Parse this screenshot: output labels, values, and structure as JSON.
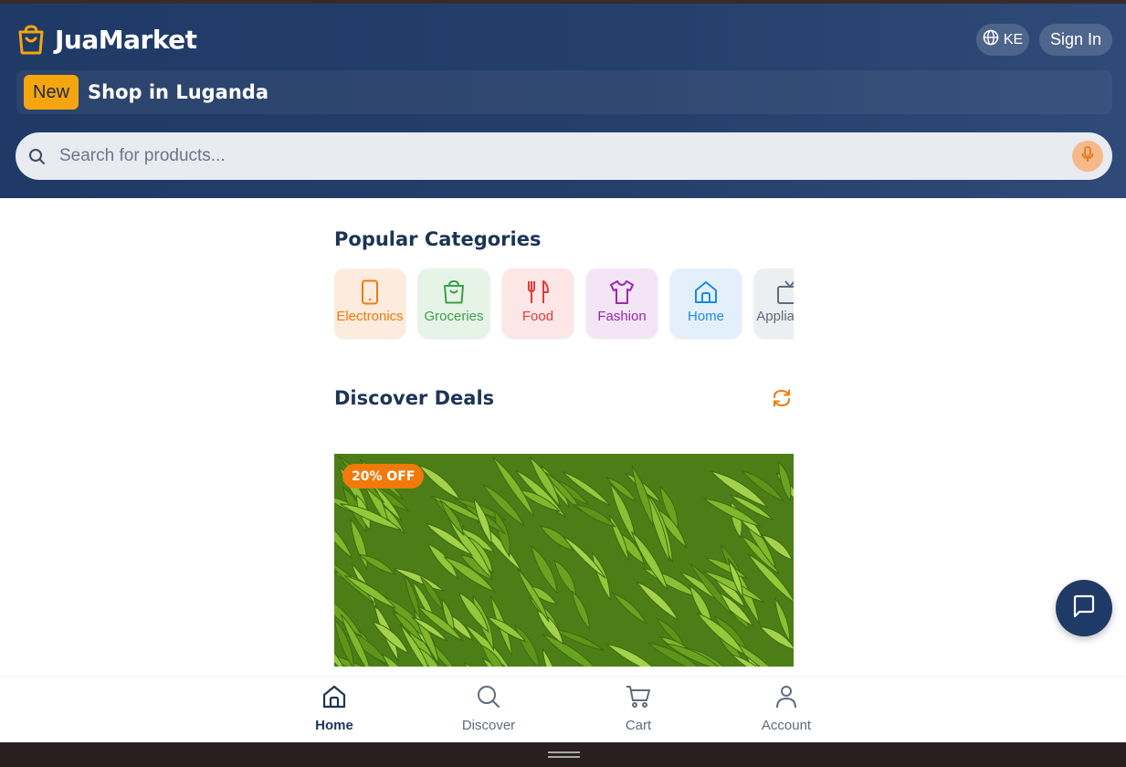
{
  "app": {
    "name": "JuaMarket"
  },
  "header": {
    "lang_code": "KE",
    "signin_label": "Sign In",
    "promo": {
      "badge": "New",
      "text": "Shop in Luganda"
    },
    "search": {
      "placeholder": "Search for products..."
    }
  },
  "categories": {
    "title": "Popular Categories",
    "items": [
      {
        "label": "Electronics",
        "icon": "phone-icon",
        "color": "#f07a0a",
        "bg": "#fdebdd"
      },
      {
        "label": "Groceries",
        "icon": "shopping-bag-icon",
        "color": "#3aa04a",
        "bg": "#e6f3e7"
      },
      {
        "label": "Food",
        "icon": "utensils-icon",
        "color": "#e53935",
        "bg": "#fde6e6"
      },
      {
        "label": "Fashion",
        "icon": "shirt-icon",
        "color": "#9c27b0",
        "bg": "#f3e5f6"
      },
      {
        "label": "Home",
        "icon": "home-icon",
        "color": "#1e88e5",
        "bg": "#e3f0fc"
      },
      {
        "label": "Appliances",
        "icon": "tv-icon",
        "color": "#5f6b7c",
        "bg": "#eceff2"
      }
    ]
  },
  "deals": {
    "title": "Discover Deals",
    "items": [
      {
        "badge": "20% OFF",
        "image": "green-bananas-photo"
      }
    ]
  },
  "bottom_nav": [
    {
      "label": "Home",
      "icon": "home-icon",
      "active": true
    },
    {
      "label": "Discover",
      "icon": "search-icon",
      "active": false
    },
    {
      "label": "Cart",
      "icon": "cart-icon",
      "active": false
    },
    {
      "label": "Account",
      "icon": "user-icon",
      "active": false
    }
  ],
  "colors": {
    "header": "#1f3a66",
    "accent": "#f5a50f",
    "deal_badge": "#f07a0a"
  }
}
